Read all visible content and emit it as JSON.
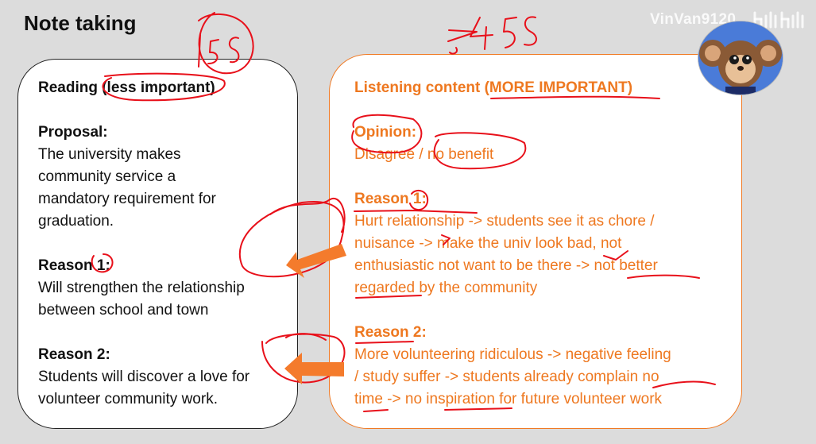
{
  "title": "Note taking",
  "watermark": "VinVan9120",
  "left_card": {
    "heading": "Reading (less important)",
    "proposal_label": "Proposal:",
    "proposal_lines": [
      "The university makes",
      "community service a",
      "mandatory requirement for",
      "graduation."
    ],
    "reason1_label": "Reason 1:",
    "reason1_lines": [
      "Will strengthen the relationship",
      "between school and town"
    ],
    "reason2_label": "Reason 2:",
    "reason2_lines": [
      "Students will discover a love for",
      "volunteer community work."
    ]
  },
  "right_card": {
    "heading": "Listening content (MORE IMPORTANT)",
    "opinion_label": "Opinion:",
    "opinion_line": "Disagree / no benefit",
    "reason1_label": "Reason 1:",
    "reason1_lines": [
      "Hurt relationship -> students see it as chore /",
      "nuisance -> make the univ look bad, not",
      "enthusiastic not want to be there -> not better",
      "regarded by the community"
    ],
    "reason2_label": "Reason 2:",
    "reason2_lines": [
      "More volunteering ridiculous -> negative feeling",
      "/ study suffer -> students already complain no",
      "time -> no inspiration for future volunteer work"
    ]
  },
  "annotations": {
    "handwritten_left": "15s",
    "handwritten_right": ">,45s"
  },
  "colors": {
    "accent": "#ee7820",
    "ink": "#e8101a",
    "arrow": "#f47b2c"
  }
}
